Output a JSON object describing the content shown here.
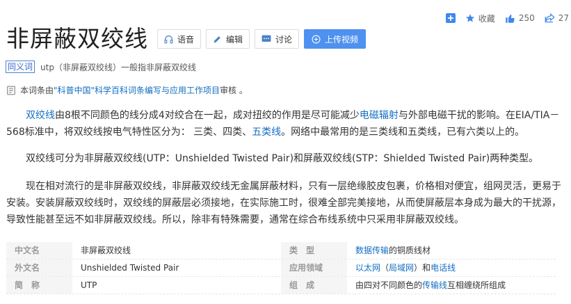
{
  "toolbar": {
    "collect_label": "收藏",
    "like_count": "250",
    "share_count": "27"
  },
  "entry": {
    "title": "非屏蔽双绞线",
    "buttons": {
      "voice": "语音",
      "edit": "编辑",
      "discuss": "讨论",
      "upload_video": "上传视频"
    }
  },
  "synonym": {
    "tag": "同义词",
    "text": "utp（非屏蔽双绞线）一般指非屏蔽双绞线"
  },
  "review": {
    "prefix": "本词条由",
    "org": "\"科普中国\"科学百科词条编写与应用工作项目",
    "suffix": " 审核 。"
  },
  "paragraphs": {
    "p1": {
      "link1": "双绞线",
      "t1": "由8根不同颜色的线分成4对绞合在一起，成对扭绞的作用是尽可能减少",
      "link2": "电磁辐射",
      "t2": "与外部电磁干扰的影响。在EIA/TIA－568标准中，将双绞线按电气特性区分为： 三类、四类、",
      "link3": "五类线",
      "t3": "。网络中最常用的是三类线和五类线，已有六类以上的。"
    },
    "p2": "双绞线可分为非屏蔽双绞线(UTP：Unshielded Twisted Pair)和屏蔽双绞线(STP：Shielded Twisted Pair)两种类型。",
    "p3": "现在相对流行的是非屏蔽双绞线，非屏蔽双绞线无金属屏蔽材料，只有一层绝缘胶皮包裹，价格相对便宜，组网灵活，更易于安装。安装屏蔽双绞线时，双绞线的屏蔽层必须接地，在实际施工时，很难全部完美接地，从而使屏蔽层本身成为最大的干扰源，导致性能甚至远不如非屏蔽双绞线。所以，除非有特殊需要，通常在综合布线系统中只采用非屏蔽双绞线。"
  },
  "infobox": {
    "rows": [
      {
        "k1": "中文名",
        "v1": "非屏蔽双绞线",
        "k2": "类　型",
        "v2_link": "数据传输",
        "v2_text": "的铜质线材"
      },
      {
        "k1": "外文名",
        "v1": "Unshielded Twisted Pair",
        "k2": "应用领域",
        "v2_link": "以太网",
        "v2_mid": "（",
        "v2_link2": "局域网",
        "v2_mid2": "）和",
        "v2_link3": "电话线"
      },
      {
        "k1": "简　称",
        "v1": "UTP",
        "k2": "组　成",
        "v2_pre": "由四对不同颜色的",
        "v2_link": "传输线",
        "v2_text": "互相缠绕所组成"
      }
    ]
  },
  "colors": {
    "accent": "#3f88ee",
    "link": "#136ec2"
  }
}
